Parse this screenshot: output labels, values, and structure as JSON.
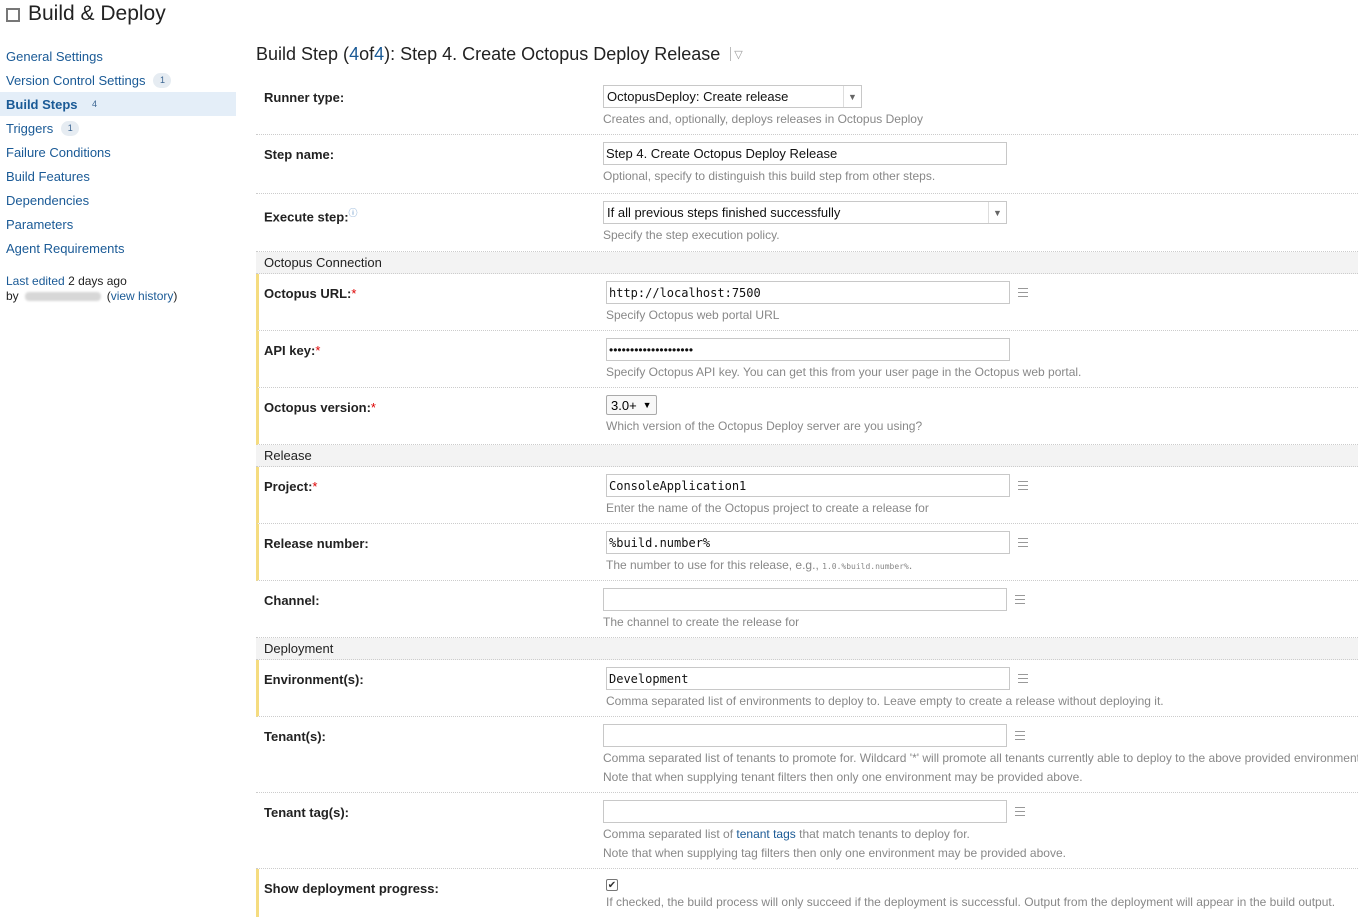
{
  "page": {
    "title": "Build & Deploy"
  },
  "sidebar": {
    "items": [
      {
        "label": "General Settings",
        "badge": ""
      },
      {
        "label": "Version Control Settings",
        "badge": "1"
      },
      {
        "label": "Build Steps",
        "badge": "4",
        "active": true
      },
      {
        "label": "Triggers",
        "badge": "1"
      },
      {
        "label": "Failure Conditions",
        "badge": ""
      },
      {
        "label": "Build Features",
        "badge": ""
      },
      {
        "label": "Dependencies",
        "badge": ""
      },
      {
        "label": "Parameters",
        "badge": ""
      },
      {
        "label": "Agent Requirements",
        "badge": ""
      }
    ],
    "last_edited_link": "Last edited",
    "last_edited_age": "2 days ago",
    "by_label": "by",
    "view_history": "view history"
  },
  "step": {
    "heading_prefix": "Build Step (",
    "current": "4",
    "of": " of ",
    "total": "4",
    "heading_suffix": "): Step 4. Create Octopus Deploy Release"
  },
  "form": {
    "runner_type": {
      "label": "Runner type:",
      "value": "OctopusDeploy: Create release",
      "hint": "Creates and, optionally, deploys releases in Octopus Deploy"
    },
    "step_name": {
      "label": "Step name:",
      "value": "Step 4. Create Octopus Deploy Release",
      "hint": "Optional, specify to distinguish this build step from other steps."
    },
    "execute_step": {
      "label": "Execute step:",
      "value": "If all previous steps finished successfully",
      "hint": "Specify the step execution policy."
    },
    "groups": {
      "connection": "Octopus Connection",
      "release": "Release",
      "deployment": "Deployment"
    },
    "octopus_url": {
      "label": "Octopus URL:",
      "value": "http://localhost:7500",
      "hint": "Specify Octopus web portal URL"
    },
    "api_key": {
      "label": "API key:",
      "value": "••••••••••••••••••••",
      "hint": "Specify Octopus API key. You can get this from your user page in the Octopus web portal."
    },
    "octopus_version": {
      "label": "Octopus version:",
      "value": "3.0+",
      "hint": "Which version of the Octopus Deploy server are you using?"
    },
    "project": {
      "label": "Project:",
      "value": "ConsoleApplication1",
      "hint": "Enter the name of the Octopus project to create a release for"
    },
    "release_number": {
      "label": "Release number:",
      "value": "%build.number%",
      "hint_prefix": "The number to use for this release, e.g., ",
      "hint_code": "1.0.%build.number%",
      "hint_suffix": "."
    },
    "channel": {
      "label": "Channel:",
      "value": "",
      "hint": "The channel to create the release for"
    },
    "environments": {
      "label": "Environment(s):",
      "value": "Development",
      "hint": "Comma separated list of environments to deploy to. Leave empty to create a release without deploying it."
    },
    "tenants": {
      "label": "Tenant(s):",
      "value": "",
      "hint1": "Comma separated list of tenants to promote for. Wildcard '*' will promote all tenants currently able to deploy to the above provided environment.",
      "hint2": "Note that when supplying tenant filters then only one environment may be provided above."
    },
    "tenant_tags": {
      "label": "Tenant tag(s):",
      "value": "",
      "hint1_prefix": "Comma separated list of ",
      "hint1_link": "tenant tags",
      "hint1_suffix": " that match tenants to deploy for.",
      "hint2": "Note that when supplying tag filters then only one environment may be provided above."
    },
    "show_progress": {
      "label": "Show deployment progress:",
      "checked": true,
      "hint": "If checked, the build process will only succeed if the deployment is successful. Output from the deployment will appear in the build output."
    }
  },
  "colors": {
    "link": "#1a5a96",
    "changed_marker": "#f5dc80",
    "group_bg": "#f3f3f3",
    "active_nav_bg": "#e4eef8"
  }
}
